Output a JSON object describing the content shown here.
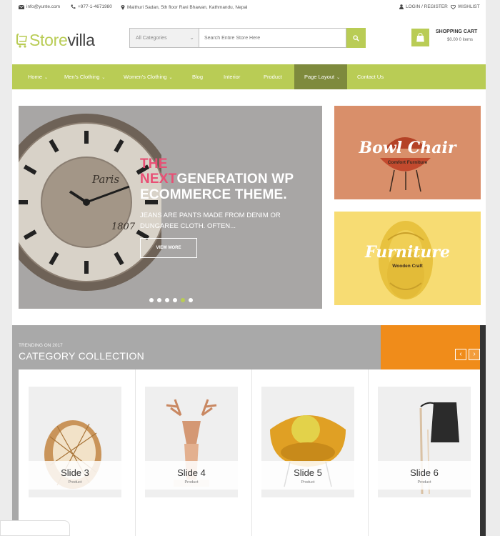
{
  "topbar": {
    "email": "info@yunte.com",
    "phone": "+977-1-4671980",
    "address": "Maithuri Sadan, 5th floor Ravi Bhawan, Kathmandu, Nepal",
    "login": "LOGIN / REGISTER",
    "wishlist": "WISHLIST"
  },
  "header": {
    "logo_store": "Store",
    "logo_villa": "villa",
    "category_select": "All Categories",
    "search_placeholder": "Search Entire Store Here",
    "cart_title": "SHOPPING CART",
    "cart_summary": "$0.00 0 items"
  },
  "nav": {
    "items": [
      {
        "label": "Home",
        "has_dropdown": true
      },
      {
        "label": "Men's Clothing",
        "has_dropdown": true
      },
      {
        "label": "Women's Clothing",
        "has_dropdown": true
      },
      {
        "label": "Blog",
        "has_dropdown": false
      },
      {
        "label": "Interior",
        "has_dropdown": false
      },
      {
        "label": "Product",
        "has_dropdown": false
      },
      {
        "label": "Page Layout",
        "has_dropdown": true,
        "active": true
      },
      {
        "label": "Contact Us",
        "has_dropdown": false
      }
    ],
    "chevron": "⌄"
  },
  "hero": {
    "title_pink_1": "THE",
    "title_pink_2": "NEXT",
    "title_line_2_rest": "GENERATION WP",
    "title_line_3": "ECOMMERCE THEME.",
    "desc_line_1": "JEANS ARE PANTS MADE FROM DENIM OR",
    "desc_line_2": "DUNGAREE CLOTH. OFTEN...",
    "button": "VIEW MORE",
    "clock_word": "Paris",
    "clock_year": "1807",
    "slide_count": 6,
    "active_slide": 5
  },
  "promos": [
    {
      "title": "Bowl Chair",
      "subtitle": "Comfort Furniture"
    },
    {
      "title": "Furniture",
      "subtitle": "Wooden Craft"
    }
  ],
  "collection": {
    "trend_label": "TRENDING ON 2017",
    "title": "CATEGORY COLLECTION",
    "prev": "‹",
    "next": "›",
    "cards": [
      {
        "title": "Slide 3",
        "subtitle": "Product"
      },
      {
        "title": "Slide 4",
        "subtitle": "Product"
      },
      {
        "title": "Slide 5",
        "subtitle": "Product"
      },
      {
        "title": "Slide 6",
        "subtitle": "Product"
      }
    ]
  },
  "colors": {
    "accent": "#b9cc55",
    "nav_active": "#7e8a3d",
    "hero_pink": "#e94f75",
    "promo_orange": "#d98f6a",
    "promo_yellow": "#f7dc73"
  }
}
